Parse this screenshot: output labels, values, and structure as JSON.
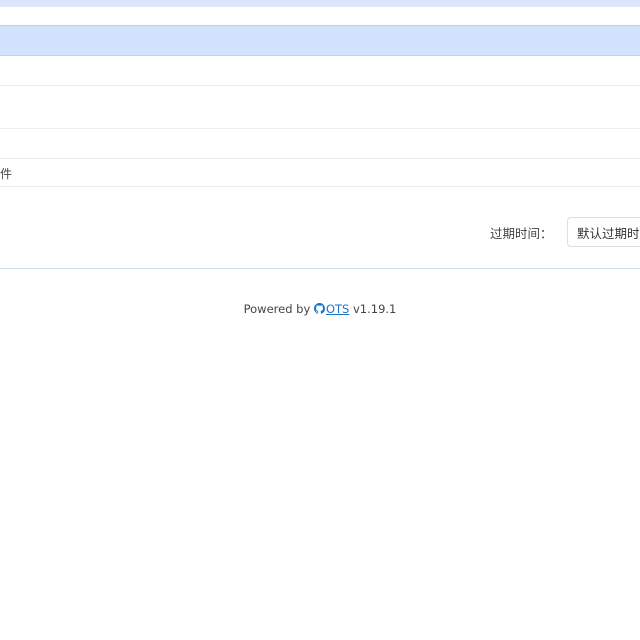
{
  "form": {
    "partial_row_text": "件",
    "expiration_label": "过期时间：",
    "expiration_select_value": "默认过期时间"
  },
  "footer": {
    "prefix": "Powered by",
    "link_text": "OTS",
    "version": "v1.19.1",
    "link_icon": "github-icon"
  },
  "colors": {
    "header_bg": "#d1e3fd",
    "link": "#1a73c9"
  }
}
